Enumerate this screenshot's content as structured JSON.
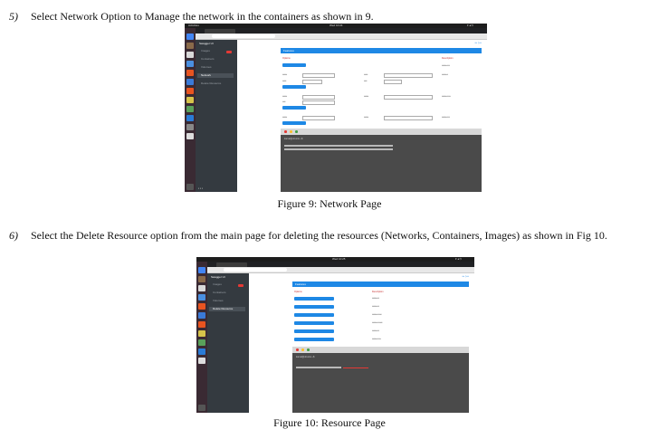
{
  "step5": {
    "number": "5)",
    "text": "Select Network Option to Manage the network in the containers as shown in 9."
  },
  "figure9": {
    "caption": "Figure 9: Network Page",
    "sidebar": {
      "brand": "Swagger UI",
      "items": [
        "Images",
        "Containers",
        "Volumes",
        "Network",
        "Delete Resource"
      ]
    },
    "bar_title": "Features",
    "options_header": "Options",
    "description_header": "Description",
    "terminal_prompt": "kamal@ubuntu:~$"
  },
  "step6": {
    "number": "6)",
    "text": "Select the Delete Resource option from the main page for deleting the resources (Networks, Containers, Images) as shown in Fig 10."
  },
  "figure10": {
    "caption": "Figure 10: Resource Page",
    "bar_title": "Features",
    "options_header": "Options",
    "description_header": "Description",
    "terminal_prompt": "kamal@ubuntu:~$"
  },
  "colors": {
    "accent": "#1e88e5",
    "sidebar": "#343a40",
    "terminal": "#4a4a4a",
    "badge": "#e53935"
  }
}
